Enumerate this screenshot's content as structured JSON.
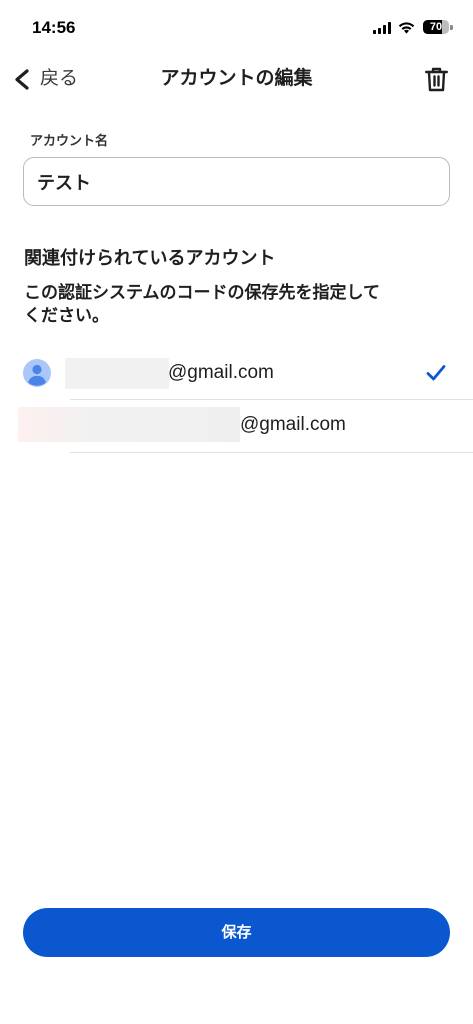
{
  "status_bar": {
    "time": "14:56",
    "battery_level": "70",
    "icons": [
      "cellular-signal-icon",
      "wifi-icon",
      "battery-icon"
    ]
  },
  "nav": {
    "back_icon": "chevron-left-icon",
    "back_label": "戻る",
    "title": "アカウントの編集",
    "delete_icon": "trash-icon"
  },
  "account_name": {
    "label": "アカウント名",
    "value": "テスト"
  },
  "linked_accounts": {
    "heading": "関連付けられているアカウント",
    "description": "この認証システムのコードの保存先を指定して\nください。",
    "items": [
      {
        "avatar_icon": "person-avatar-icon",
        "email_suffix": "@gmail.com",
        "selected": true,
        "selected_icon": "checkmark-icon"
      },
      {
        "email_suffix": "@gmail.com",
        "selected": false
      }
    ]
  },
  "save_button": {
    "label": "保存"
  },
  "colors": {
    "accent": "#0b57d0",
    "text": "#1f1f1f",
    "avatar_bg": "#a9c8f9",
    "avatar_fg": "#4a84e8",
    "divider": "#e2e2e2"
  }
}
